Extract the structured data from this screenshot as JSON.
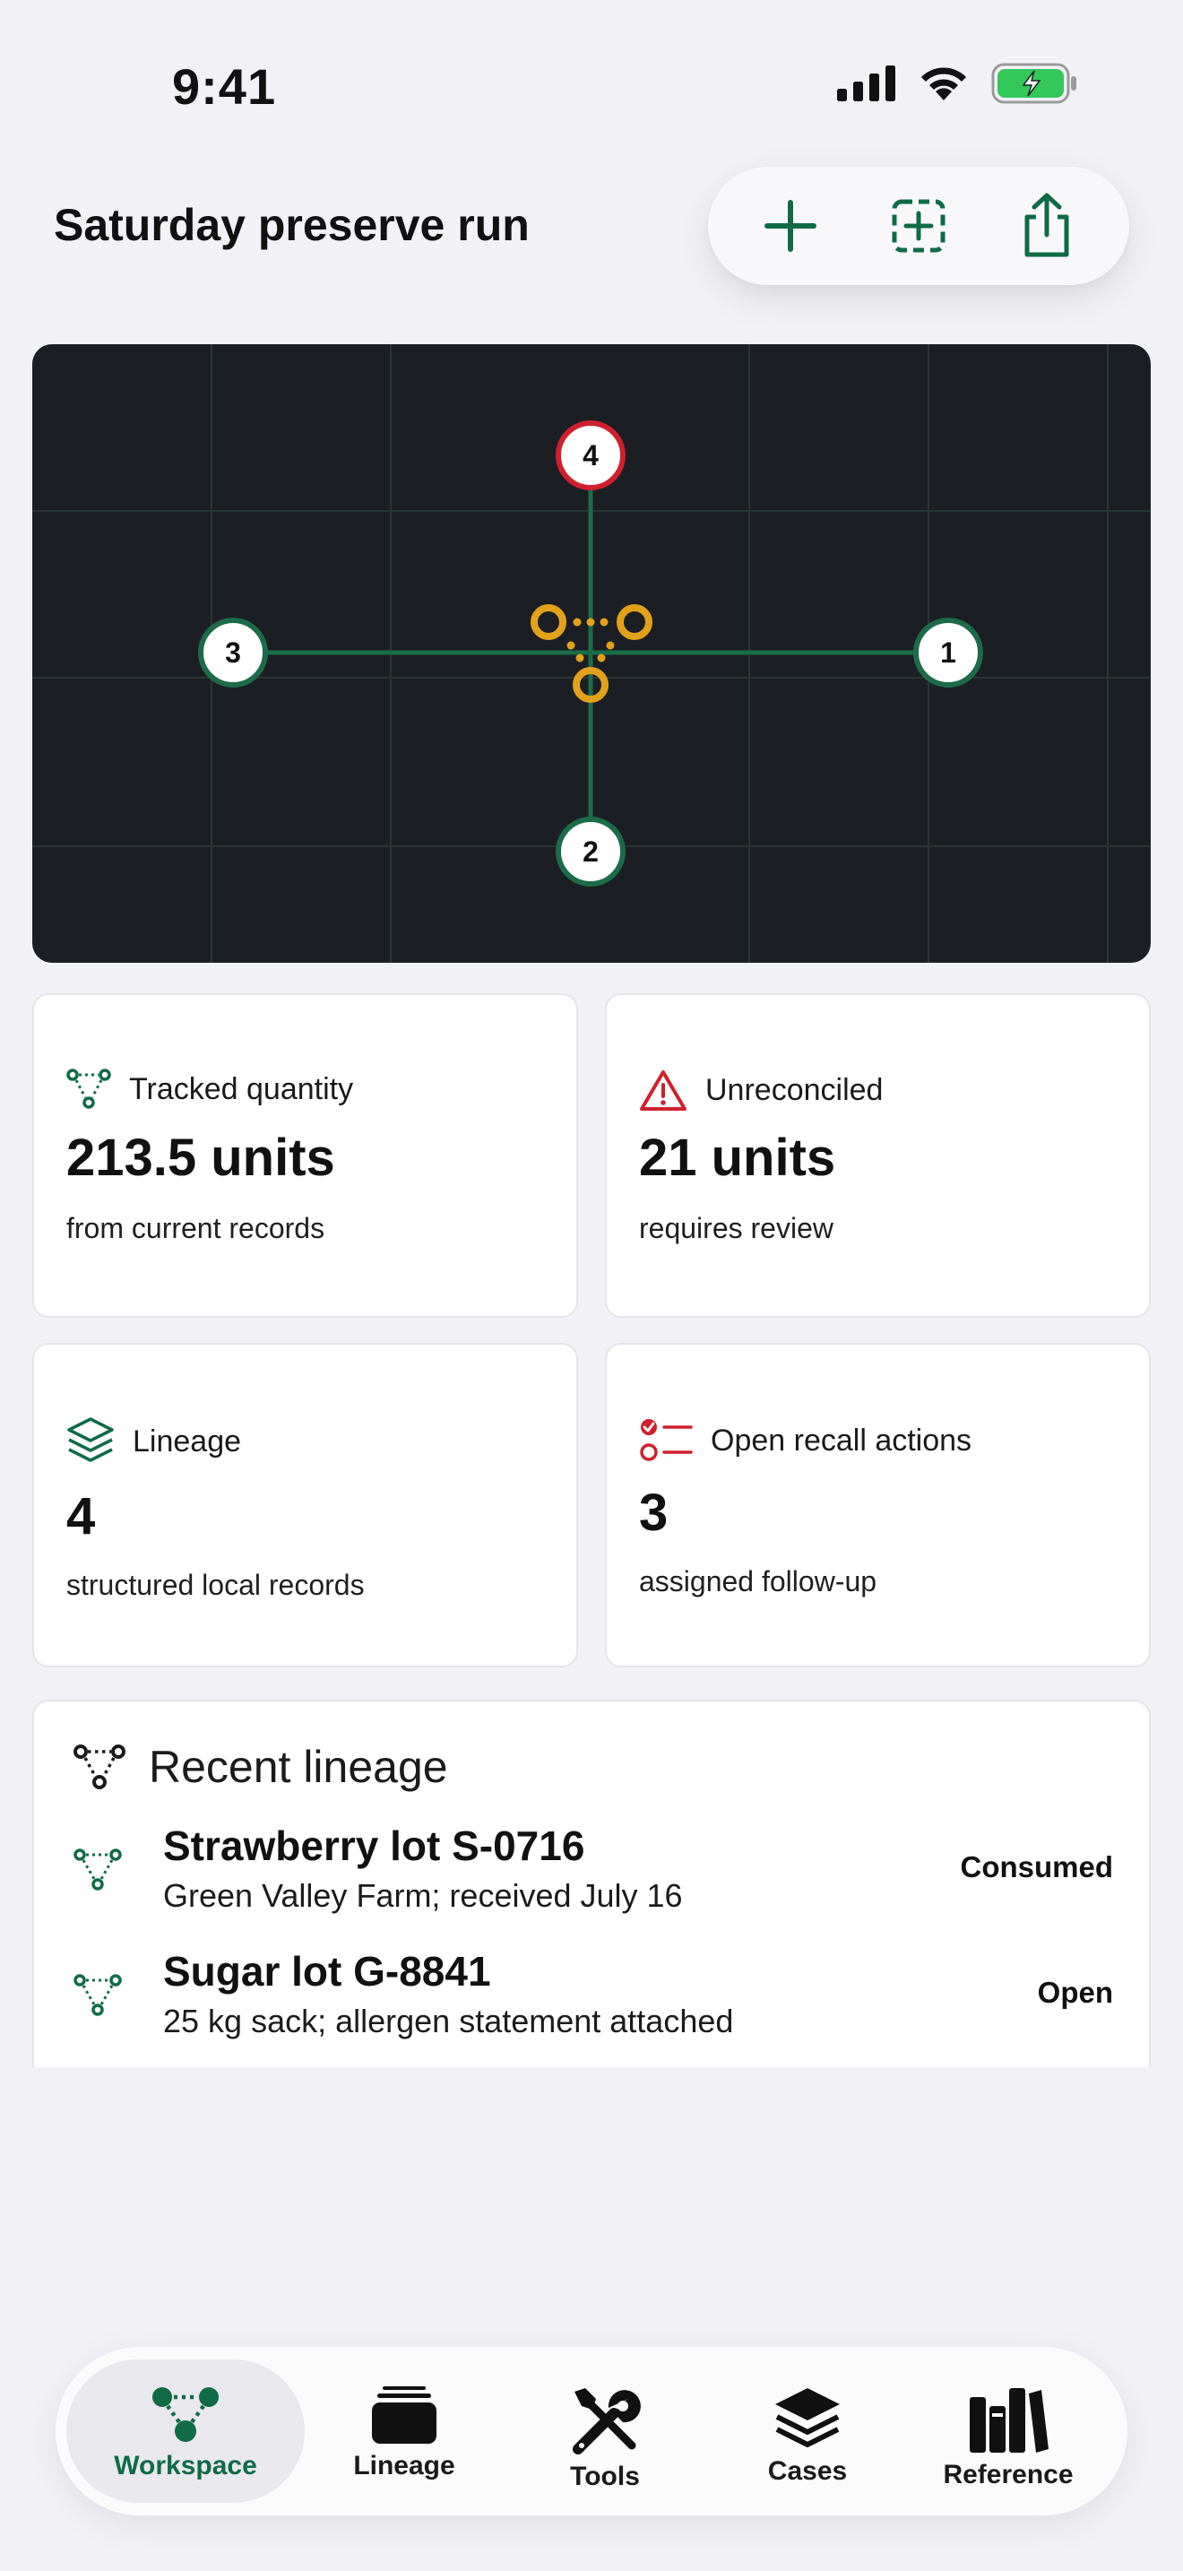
{
  "status_bar": {
    "time": "9:41"
  },
  "header": {
    "title": "Saturday preserve run",
    "actions": [
      {
        "icon": "plus-icon"
      },
      {
        "icon": "add-square-icon"
      },
      {
        "icon": "share-icon"
      }
    ]
  },
  "map": {
    "nodes": [
      {
        "label": "4",
        "state": "alert"
      },
      {
        "label": "3",
        "state": "ok"
      },
      {
        "label": "1",
        "state": "ok"
      },
      {
        "label": "2",
        "state": "ok"
      }
    ]
  },
  "metrics": [
    {
      "icon": "lineage-icon",
      "label": "Tracked quantity",
      "value": "213.5 units",
      "sub": "from current records"
    },
    {
      "icon": "warning-icon",
      "label": "Unreconciled",
      "value": "21 units",
      "sub": "requires review"
    },
    {
      "icon": "layers-icon",
      "label": "Lineage",
      "value": "4",
      "sub": "structured local records"
    },
    {
      "icon": "checklist-icon",
      "label": "Open recall actions",
      "value": "3",
      "sub": "assigned follow-up"
    }
  ],
  "recent": {
    "title": "Recent lineage",
    "items": [
      {
        "title": "Strawberry lot S-0716",
        "sub": "Green Valley Farm; received July 16",
        "status": "Consumed"
      },
      {
        "title": "Sugar lot G-8841",
        "sub": "25 kg sack; allergen statement attached",
        "status": "Open"
      }
    ]
  },
  "tabs": [
    {
      "label": "Workspace",
      "icon": "workspace-icon",
      "active": true
    },
    {
      "label": "Lineage",
      "icon": "tray-icon",
      "active": false
    },
    {
      "label": "Tools",
      "icon": "tools-icon",
      "active": false
    },
    {
      "label": "Cases",
      "icon": "stack-icon",
      "active": false
    },
    {
      "label": "Reference",
      "icon": "books-icon",
      "active": false
    }
  ],
  "colors": {
    "accent": "#0f6b46",
    "alert": "#d0202e",
    "hub": "#e3a11b",
    "map_bg": "#1b1f23"
  }
}
